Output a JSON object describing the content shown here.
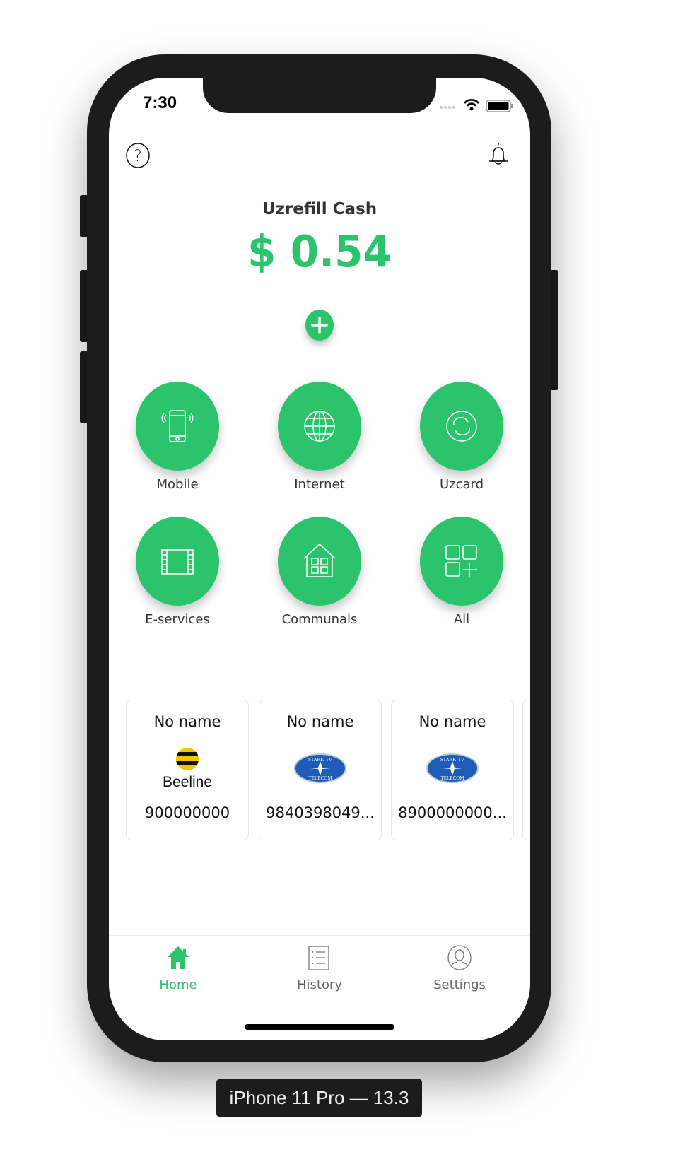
{
  "status_bar": {
    "time": "7:30"
  },
  "balance": {
    "title": "Uzrefill Cash",
    "amount": "$ 0.54"
  },
  "colors": {
    "accent": "#2BC36B",
    "inactive": "#666666"
  },
  "services": [
    {
      "label": "Mobile",
      "icon": "mobile-phone-icon"
    },
    {
      "label": "Internet",
      "icon": "globe-icon"
    },
    {
      "label": "Uzcard",
      "icon": "exchange-icon"
    },
    {
      "label": "E-services",
      "icon": "film-icon"
    },
    {
      "label": "Communals",
      "icon": "house-icon"
    },
    {
      "label": "All",
      "icon": "grid-plus-icon"
    }
  ],
  "saved": [
    {
      "name": "No name",
      "logo": "Beeline",
      "number": "900000000"
    },
    {
      "name": "No name",
      "logo": "STARK-TV TELECOM",
      "number": "9840398049..."
    },
    {
      "name": "No name",
      "logo": "STARK-TV TELECOM",
      "number": "8900000000..."
    }
  ],
  "tabs": [
    {
      "label": "Home",
      "active": true
    },
    {
      "label": "History"
    },
    {
      "label": "Settings"
    }
  ],
  "device_label": "iPhone 11 Pro — 13.3"
}
